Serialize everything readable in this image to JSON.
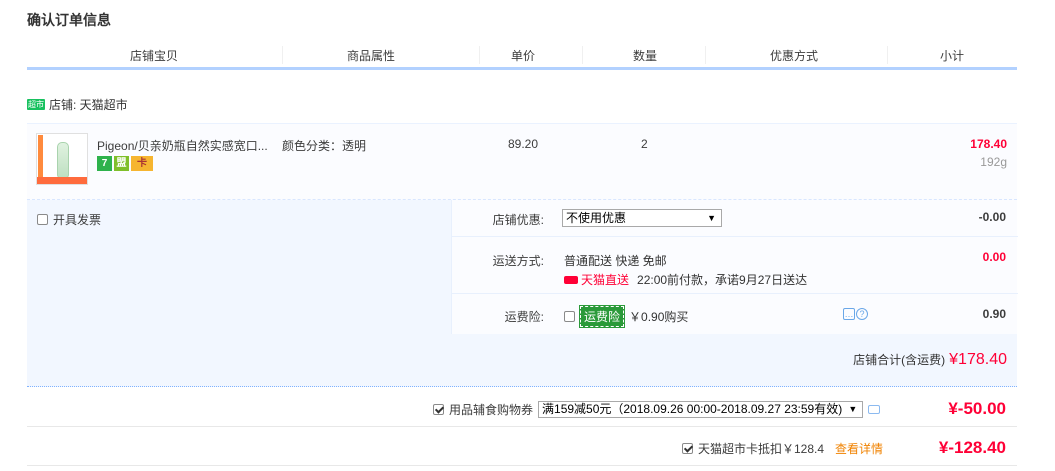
{
  "page_title": "确认订单信息",
  "columns": [
    "店铺宝贝",
    "商品属性",
    "单价",
    "数量",
    "优惠方式",
    "小计"
  ],
  "shop": {
    "badge": "超市",
    "label": "店铺: 天猫超市"
  },
  "item": {
    "name": "Pigeon/贝亲奶瓶自然实感宽口...",
    "attr": "颜色分类：透明",
    "price": "89.20",
    "qty": "2",
    "subtotal": "178.40",
    "weight": "192g",
    "badges": [
      "7",
      "盟",
      "卡"
    ]
  },
  "invoice": {
    "label": "开具发票",
    "checked": false
  },
  "shop_discount": {
    "label": "店铺优惠:",
    "selected": "不使用优惠",
    "amount": "-0.00"
  },
  "shipping": {
    "label": "运送方式:",
    "method": "普通配送 快递 免邮",
    "tmall_send": "天猫直送",
    "promise": "22:00前付款，承诺9月27日送达",
    "amount": "0.00"
  },
  "insurance": {
    "label": "运费险:",
    "tag": "运费险",
    "desc": "￥0.90购买",
    "amount": "0.90",
    "checked": false
  },
  "shop_total": {
    "label": "店铺合计(含运费)",
    "value": "¥178.40"
  },
  "coupon": {
    "label": "用品辅食购物券",
    "selected": "满159减50元（2018.09.26 00:00-2018.09.27 23:59有效)",
    "amount": "¥-50.00",
    "checked": true
  },
  "card_credit": {
    "label": "天猫超市卡抵扣￥128.4",
    "detail": "查看详情",
    "amount": "¥-128.40",
    "checked": true
  }
}
